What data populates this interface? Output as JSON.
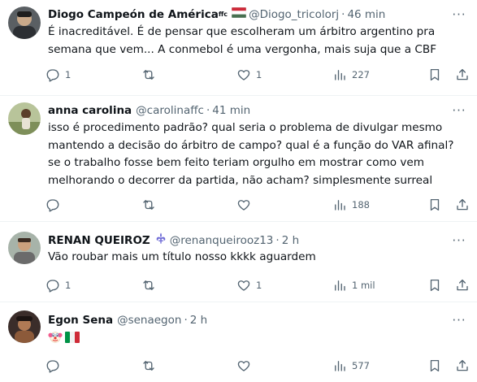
{
  "tweets": [
    {
      "name": "Diogo Campeón de América",
      "name_suffix": "ffc",
      "handle": "@Diogo_tricolorj",
      "time": "46 min",
      "text": "É inacreditável. É de pensar que escolheram um árbitro argentino pra semana que vem... A conmebol é uma vergonha, mais suja que a CBF",
      "replies": "1",
      "retweets": "",
      "likes": "1",
      "views": "227"
    },
    {
      "name": "anna carolina",
      "handle": "@carolinaffc",
      "time": "41 min",
      "text": "isso é procedimento padrão? qual seria o problema de divulgar mesmo mantendo a decisão do árbitro de campo? qual é a função do VAR afinal? se o trabalho fosse bem feito teriam orgulho em mostrar como vem melhorando o decorrer da partida, não acham? simplesmente surreal",
      "replies": "",
      "retweets": "",
      "likes": "",
      "views": "188"
    },
    {
      "name": "RENAN QUEIROZ",
      "handle": "@renanqueirooz13",
      "time": "2 h",
      "text": "Vão roubar mais um título nosso kkkk aguardem",
      "replies": "1",
      "retweets": "",
      "likes": "1",
      "views": "1 mil"
    },
    {
      "name": "Egon Sena",
      "handle": "@senaegon",
      "time": "2 h",
      "text": "",
      "emojis": [
        "clown-face-emoji",
        "italy-flag-emoji"
      ],
      "replies": "",
      "retweets": "",
      "likes": "",
      "views": "577"
    }
  ],
  "separator": "·",
  "more_glyph": "···",
  "colors": {
    "text": "#0f1419",
    "secondary": "#536471",
    "divider": "#eff3f4",
    "hungary_flag": [
      "#ce2939",
      "#ffffff",
      "#477050"
    ]
  },
  "icons": {
    "reply": "reply-icon",
    "retweet": "retweet-icon",
    "like": "heart-icon",
    "views": "views-chart-icon",
    "bookmark": "bookmark-icon",
    "share": "share-icon",
    "more": "more-options-icon"
  }
}
